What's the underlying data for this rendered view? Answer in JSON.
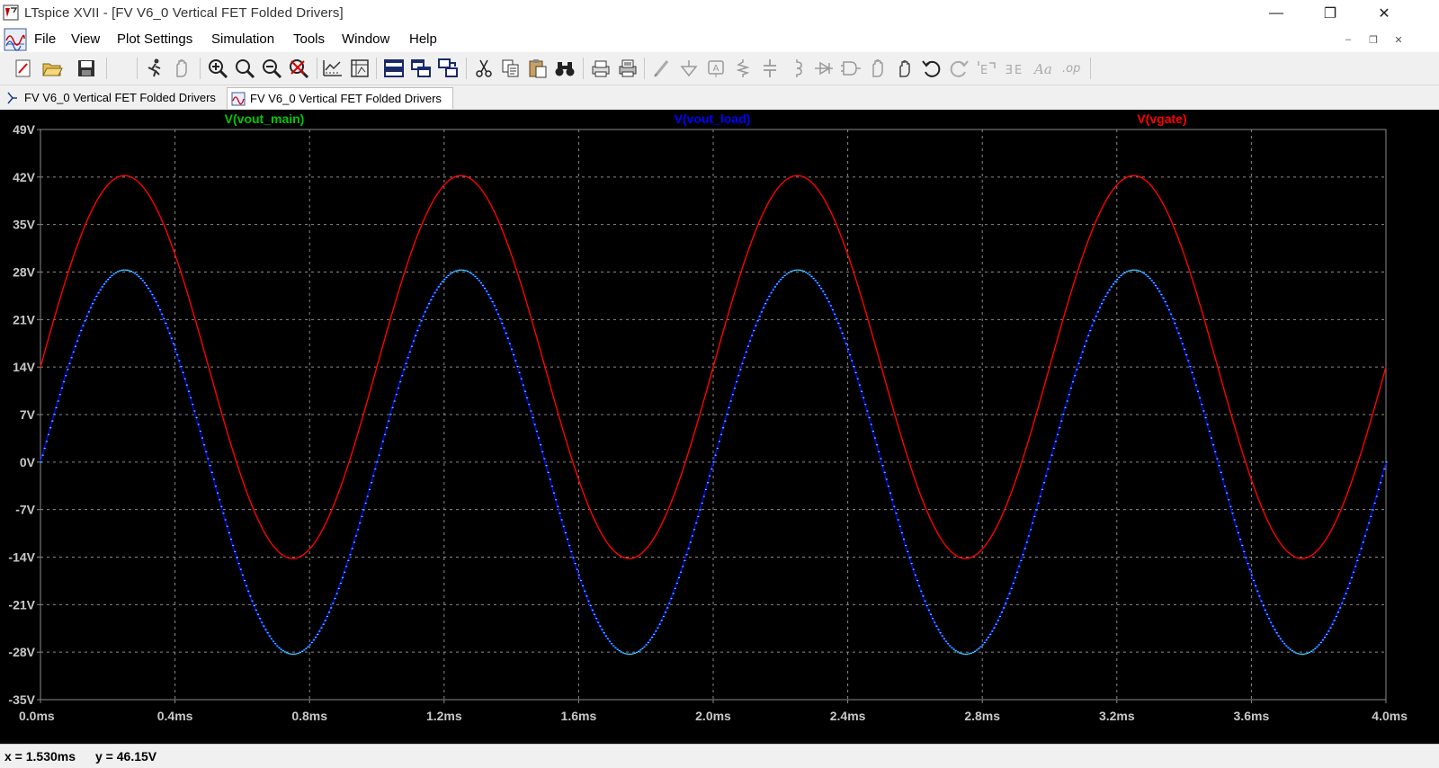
{
  "window": {
    "title": "LTspice XVII - [FV V6_0 Vertical FET Folded Drivers]",
    "minimize_glyph": "—",
    "restore_glyph": "❐",
    "close_glyph": "✕"
  },
  "menu": {
    "items": [
      "File",
      "View",
      "Plot Settings",
      "Simulation",
      "Tools",
      "Window",
      "Help"
    ],
    "mdi_minimize_glyph": "–",
    "mdi_restore_glyph": "❐",
    "mdi_close_glyph": "✕"
  },
  "toolbar": {
    "icons": [
      "new-schematic-icon",
      "open-icon",
      "save-icon",
      "run-icon",
      "halt-icon",
      "zoom-in-icon",
      "zoom-full-icon",
      "zoom-out-icon",
      "zoom-cancel-icon",
      "autorange-icon",
      "mark-icon",
      "tile-horizontal-icon",
      "tile-vertical-icon",
      "cascade-icon",
      "cut-icon",
      "copy-icon",
      "paste-icon",
      "find-icon",
      "print-setup-icon",
      "print-icon",
      "wire-icon",
      "ground-icon",
      "label-icon",
      "resistor-icon",
      "capacitor-icon",
      "inductor-icon",
      "diode-icon",
      "component-icon",
      "move-icon",
      "drag-icon",
      "undo-icon",
      "redo-icon",
      "rotate-icon",
      "mirror-icon",
      "text-icon",
      "spice-directive-icon"
    ]
  },
  "tabs": [
    {
      "label": "FV V6_0 Vertical FET Folded Drivers",
      "icon": "schematic-icon",
      "active": false
    },
    {
      "label": "FV V6_0 Vertical FET Folded Drivers",
      "icon": "waveform-icon",
      "active": true
    }
  ],
  "colors": {
    "plot_background": "#000000",
    "grid": "#8a8a8a",
    "vout_main": "#00c800",
    "vout_load": "#0000ff",
    "vgate": "#ff0000",
    "vout_overlay": "#40e0e0"
  },
  "status": {
    "x_readout": "x = 1.530ms",
    "y_readout": "y = 46.15V"
  },
  "chart_data": {
    "type": "line",
    "title": "",
    "xlabel": "",
    "ylabel": "",
    "xlim": [
      0.0,
      4.0
    ],
    "ylim": [
      -35,
      49
    ],
    "grid": true,
    "x_unit": "ms",
    "y_unit": "V",
    "x_ticks": [
      "0.0ms",
      "0.4ms",
      "0.8ms",
      "1.2ms",
      "1.6ms",
      "2.0ms",
      "2.4ms",
      "2.8ms",
      "3.2ms",
      "3.6ms",
      "4.0ms"
    ],
    "y_ticks": [
      "49V",
      "42V",
      "35V",
      "28V",
      "21V",
      "14V",
      "7V",
      "0V",
      "-7V",
      "-14V",
      "-21V",
      "-28V",
      "-35V"
    ],
    "x_tick_values": [
      0.0,
      0.4,
      0.8,
      1.2,
      1.6,
      2.0,
      2.4,
      2.8,
      3.2,
      3.6,
      4.0
    ],
    "y_tick_values": [
      49,
      42,
      35,
      28,
      21,
      14,
      7,
      0,
      -7,
      -14,
      -21,
      -28,
      -35
    ],
    "series": [
      {
        "name": "V(vout_main)",
        "color": "#00c800",
        "offset": 0,
        "amplitude": 28.3,
        "frequency_khz": 1.0,
        "phase_deg": 0,
        "visible_trace": false
      },
      {
        "name": "V(vout_load)",
        "color": "#0000ff",
        "offset": 0,
        "amplitude": 28.3,
        "frequency_khz": 1.0,
        "phase_deg": 0,
        "visible_trace": true
      },
      {
        "name": "V(vgate)",
        "color": "#ff0000",
        "offset": 14.0,
        "amplitude": 28.2,
        "frequency_khz": 1.0,
        "phase_deg": 0,
        "visible_trace": true
      }
    ],
    "sample_points": {
      "x": [
        0.0,
        0.25,
        0.5,
        0.75,
        1.0,
        1.25,
        1.5,
        1.75,
        2.0,
        2.25,
        2.5,
        2.75,
        3.0,
        3.25,
        3.5,
        3.75,
        4.0
      ],
      "V(vout_load)": [
        0,
        28.3,
        0,
        -28.3,
        0,
        28.3,
        0,
        -28.3,
        0,
        28.3,
        0,
        -28.3,
        0,
        28.3,
        0,
        -28.3,
        0
      ],
      "V(vgate)": [
        14,
        42.2,
        14,
        -14.2,
        14,
        42.2,
        14,
        -14.2,
        14,
        42.2,
        14,
        -14.2,
        14,
        42.2,
        14,
        -14.2,
        14
      ]
    }
  }
}
